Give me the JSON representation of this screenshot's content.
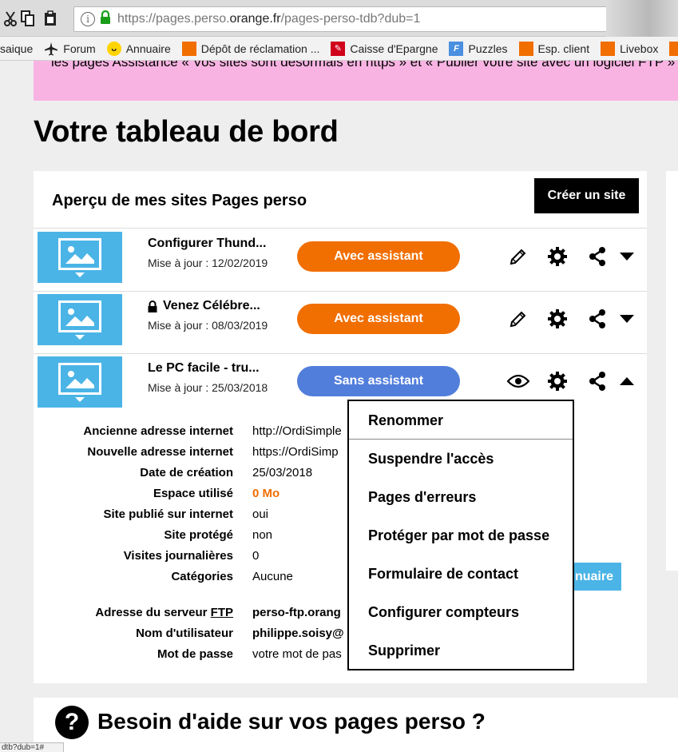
{
  "browser": {
    "url_prefix": "https://pages.perso.",
    "url_host": "orange.fr",
    "url_path": "/pages-perso-tdb?dub=1",
    "bookmarks": [
      "saique",
      "Forum",
      "Annuaire",
      "Dépôt de réclamation ...",
      "Caisse d'Epargne",
      "Puzzles",
      "Esp. client",
      "Livebox",
      "F"
    ],
    "status_text": "dtb?dub=1#"
  },
  "banner": {
    "text": "les pages Assistance « Vos sites sont désormais en https » et « Publier votre site avec un logiciel FTP »"
  },
  "page": {
    "title": "Votre tableau de bord"
  },
  "panel": {
    "title": "Aperçu de mes sites Pages perso",
    "create_label": "Créer un site"
  },
  "sites": [
    {
      "name": "Configurer Thund...",
      "date": "Mise à jour : 12/02/2019",
      "button": "Avec assistant",
      "locked": false
    },
    {
      "name": "Venez Célébre...",
      "date": "Mise à jour : 08/03/2019",
      "button": "Avec assistant",
      "locked": true
    },
    {
      "name": "Le PC facile - tru...",
      "date": "Mise à jour : 25/03/2018",
      "button": "Sans assistant",
      "locked": false
    }
  ],
  "details": [
    {
      "label": "Ancienne adresse internet",
      "value": "http://OrdiSimple"
    },
    {
      "label": "Nouvelle adresse internet",
      "value": "https://OrdiSimp"
    },
    {
      "label": "Date de création",
      "value": "25/03/2018"
    },
    {
      "label": "Espace utilisé",
      "value": "0 Mo"
    },
    {
      "label": "Site publié sur internet",
      "value": "oui"
    },
    {
      "label": "Site protégé",
      "value": "non"
    },
    {
      "label": "Visites journalières",
      "value": "0"
    },
    {
      "label": "Catégories",
      "value": "Aucune"
    }
  ],
  "ftp": {
    "server_label_pre": "Adresse du serveur ",
    "server_label_abbr": "FTP",
    "server_value": "perso-ftp.orang",
    "user_label": "Nom d'utilisateur",
    "user_value": "philippe.soisy@",
    "pass_label": "Mot de passe",
    "pass_value": "votre mot de pas"
  },
  "annuaire_label": "nuaire",
  "menu": {
    "items": [
      "Renommer",
      "Suspendre l'accès",
      "Pages d'erreurs",
      "Protéger par mot de passe",
      "Formulaire de contact",
      "Configurer compteurs",
      "Supprimer"
    ]
  },
  "help": {
    "icon": "?",
    "title": "Besoin d'aide sur vos pages perso ?"
  },
  "colors": {
    "orange": "#f16e00",
    "blue_button": "#527edb",
    "thumb_blue": "#4bb4e6",
    "banner_pink": "#f9b3e3"
  }
}
